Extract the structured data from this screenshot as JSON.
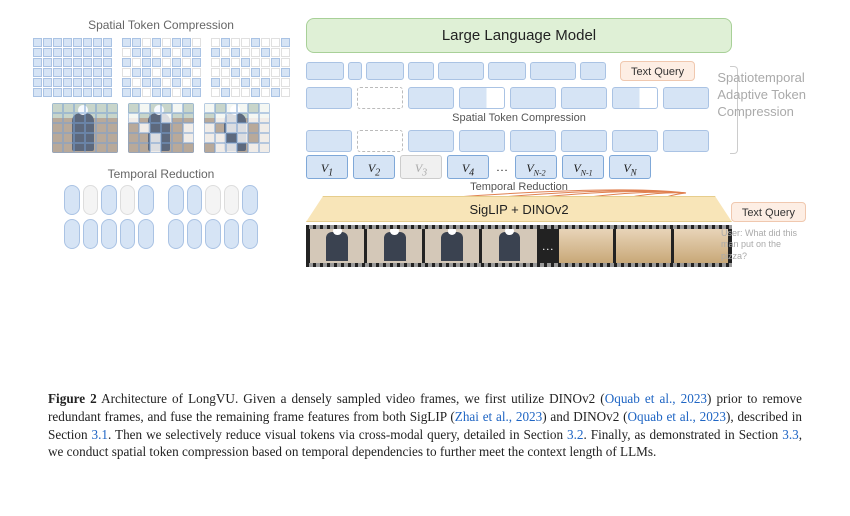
{
  "left_panel": {
    "spatial_title": "Spatial Token Compression",
    "temporal_title": "Temporal Reduction"
  },
  "right_panel": {
    "llm_label": "Large Language Model",
    "text_query_label": "Text Query",
    "spatial_label": "Spatial Token Compression",
    "temporal_label": "Temporal Reduction",
    "encoder_label": "SigLIP + DINOv2",
    "v_tokens": [
      "V₁",
      "V₂",
      "V₃",
      "V₄",
      "V_{N-2}",
      "V_{N-1}",
      "V_N"
    ],
    "ellipsis": "…",
    "side_annotation_l1": "Spatiotemporal",
    "side_annotation_l2": "Adaptive Token",
    "side_annotation_l3": "Compression",
    "user_query": "User: What did this man put on the pizza?"
  },
  "caption": {
    "fig_label": "Figure 2",
    "body_1": " Architecture of LongVU. Given a densely sampled video frames, we first utilize DINOv2 (",
    "cite_1": "Oquab et al., 2023",
    "body_2": ") prior to remove redundant frames, and fuse the remaining frame features from both SigLIP (",
    "cite_2": "Zhai et al., 2023",
    "body_3": ") and DINOv2 (",
    "cite_3": "Oquab et al., 2023",
    "body_4": "), described in Section ",
    "sec_1": "3.1",
    "body_5": ". Then we selectively reduce visual tokens via cross-modal query, detailed in Section ",
    "sec_2": "3.2",
    "body_6": ". Finally, as demonstrated in Section ",
    "sec_3": "3.3",
    "body_7": ", we conduct spatial token compression based on temporal dependencies to further meet the context length of LLMs."
  }
}
